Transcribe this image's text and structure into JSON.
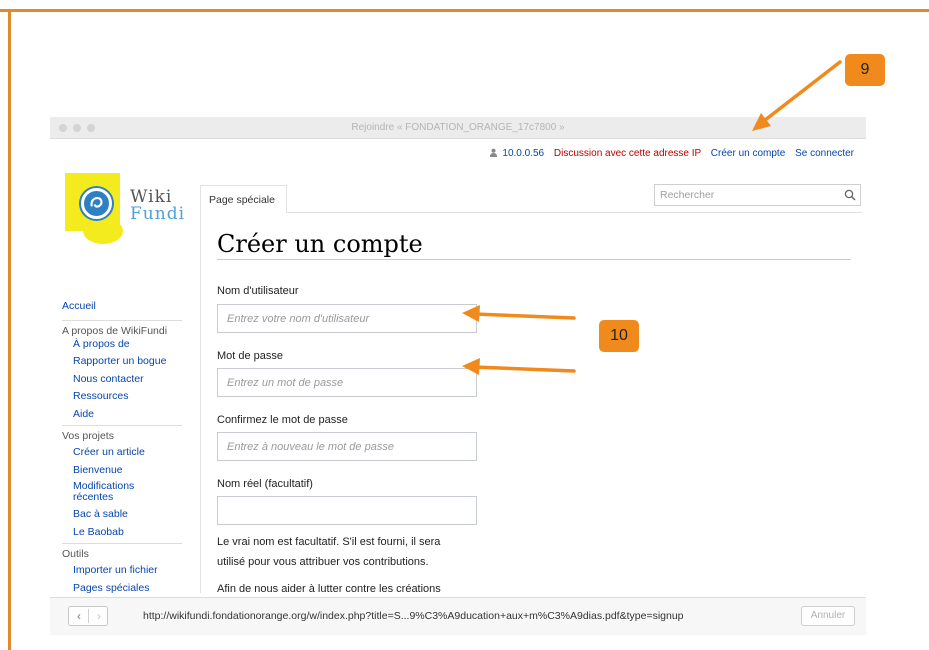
{
  "window": {
    "title": "Rejoindre « FONDATION_ORANGE_17c7800 »"
  },
  "userlinks": {
    "ip": "10.0.0.56",
    "discussion": "Discussion avec cette adresse IP",
    "create_account": "Créer un compte",
    "login": "Se connecter"
  },
  "logo": {
    "line1": "Wiki",
    "line2": "Fundi"
  },
  "sidebar": {
    "home": "Accueil",
    "section1": {
      "title": "A propos de WikiFundi",
      "items": [
        "À propos de",
        "Rapporter un bogue",
        "Nous contacter",
        "Ressources",
        "Aide"
      ]
    },
    "section2": {
      "title": "Vos projets",
      "items": [
        "Créer un article",
        "Bienvenue",
        "Modifications récentes",
        "Bac à sable",
        "Le Baobab"
      ]
    },
    "section3": {
      "title": "Outils",
      "items": [
        "Importer un fichier",
        "Pages spéciales"
      ]
    }
  },
  "tabs": {
    "special": "Page spéciale"
  },
  "search": {
    "placeholder": "Rechercher",
    "icon": "search-icon"
  },
  "form": {
    "heading": "Créer un compte",
    "username_label": "Nom d'utilisateur",
    "username_placeholder": "Entrez votre nom d'utilisateur",
    "password_label": "Mot de passe",
    "password_placeholder": "Entrez un mot de passe",
    "confirm_label": "Confirmez le mot de passe",
    "confirm_placeholder": "Entrez à nouveau le mot de passe",
    "realname_label": "Nom réel (facultatif)",
    "realname_value": "",
    "help_line1": "Le vrai nom est facultatif. S'il est fourni, il sera",
    "help_line2": "utilisé pour vous attribuer vos contributions.",
    "help2_line1": "Afin de nous aider à lutter contre les créations"
  },
  "statusbar": {
    "url": "http://wikifundi.fondationorange.org/w/index.php?title=S...9%C3%A9ducation+aux+m%C3%A9dias.pdf&type=signup",
    "cancel": "Annuler"
  },
  "annotations": {
    "step9": "9",
    "step10": "10",
    "color": "#f08a1c"
  }
}
